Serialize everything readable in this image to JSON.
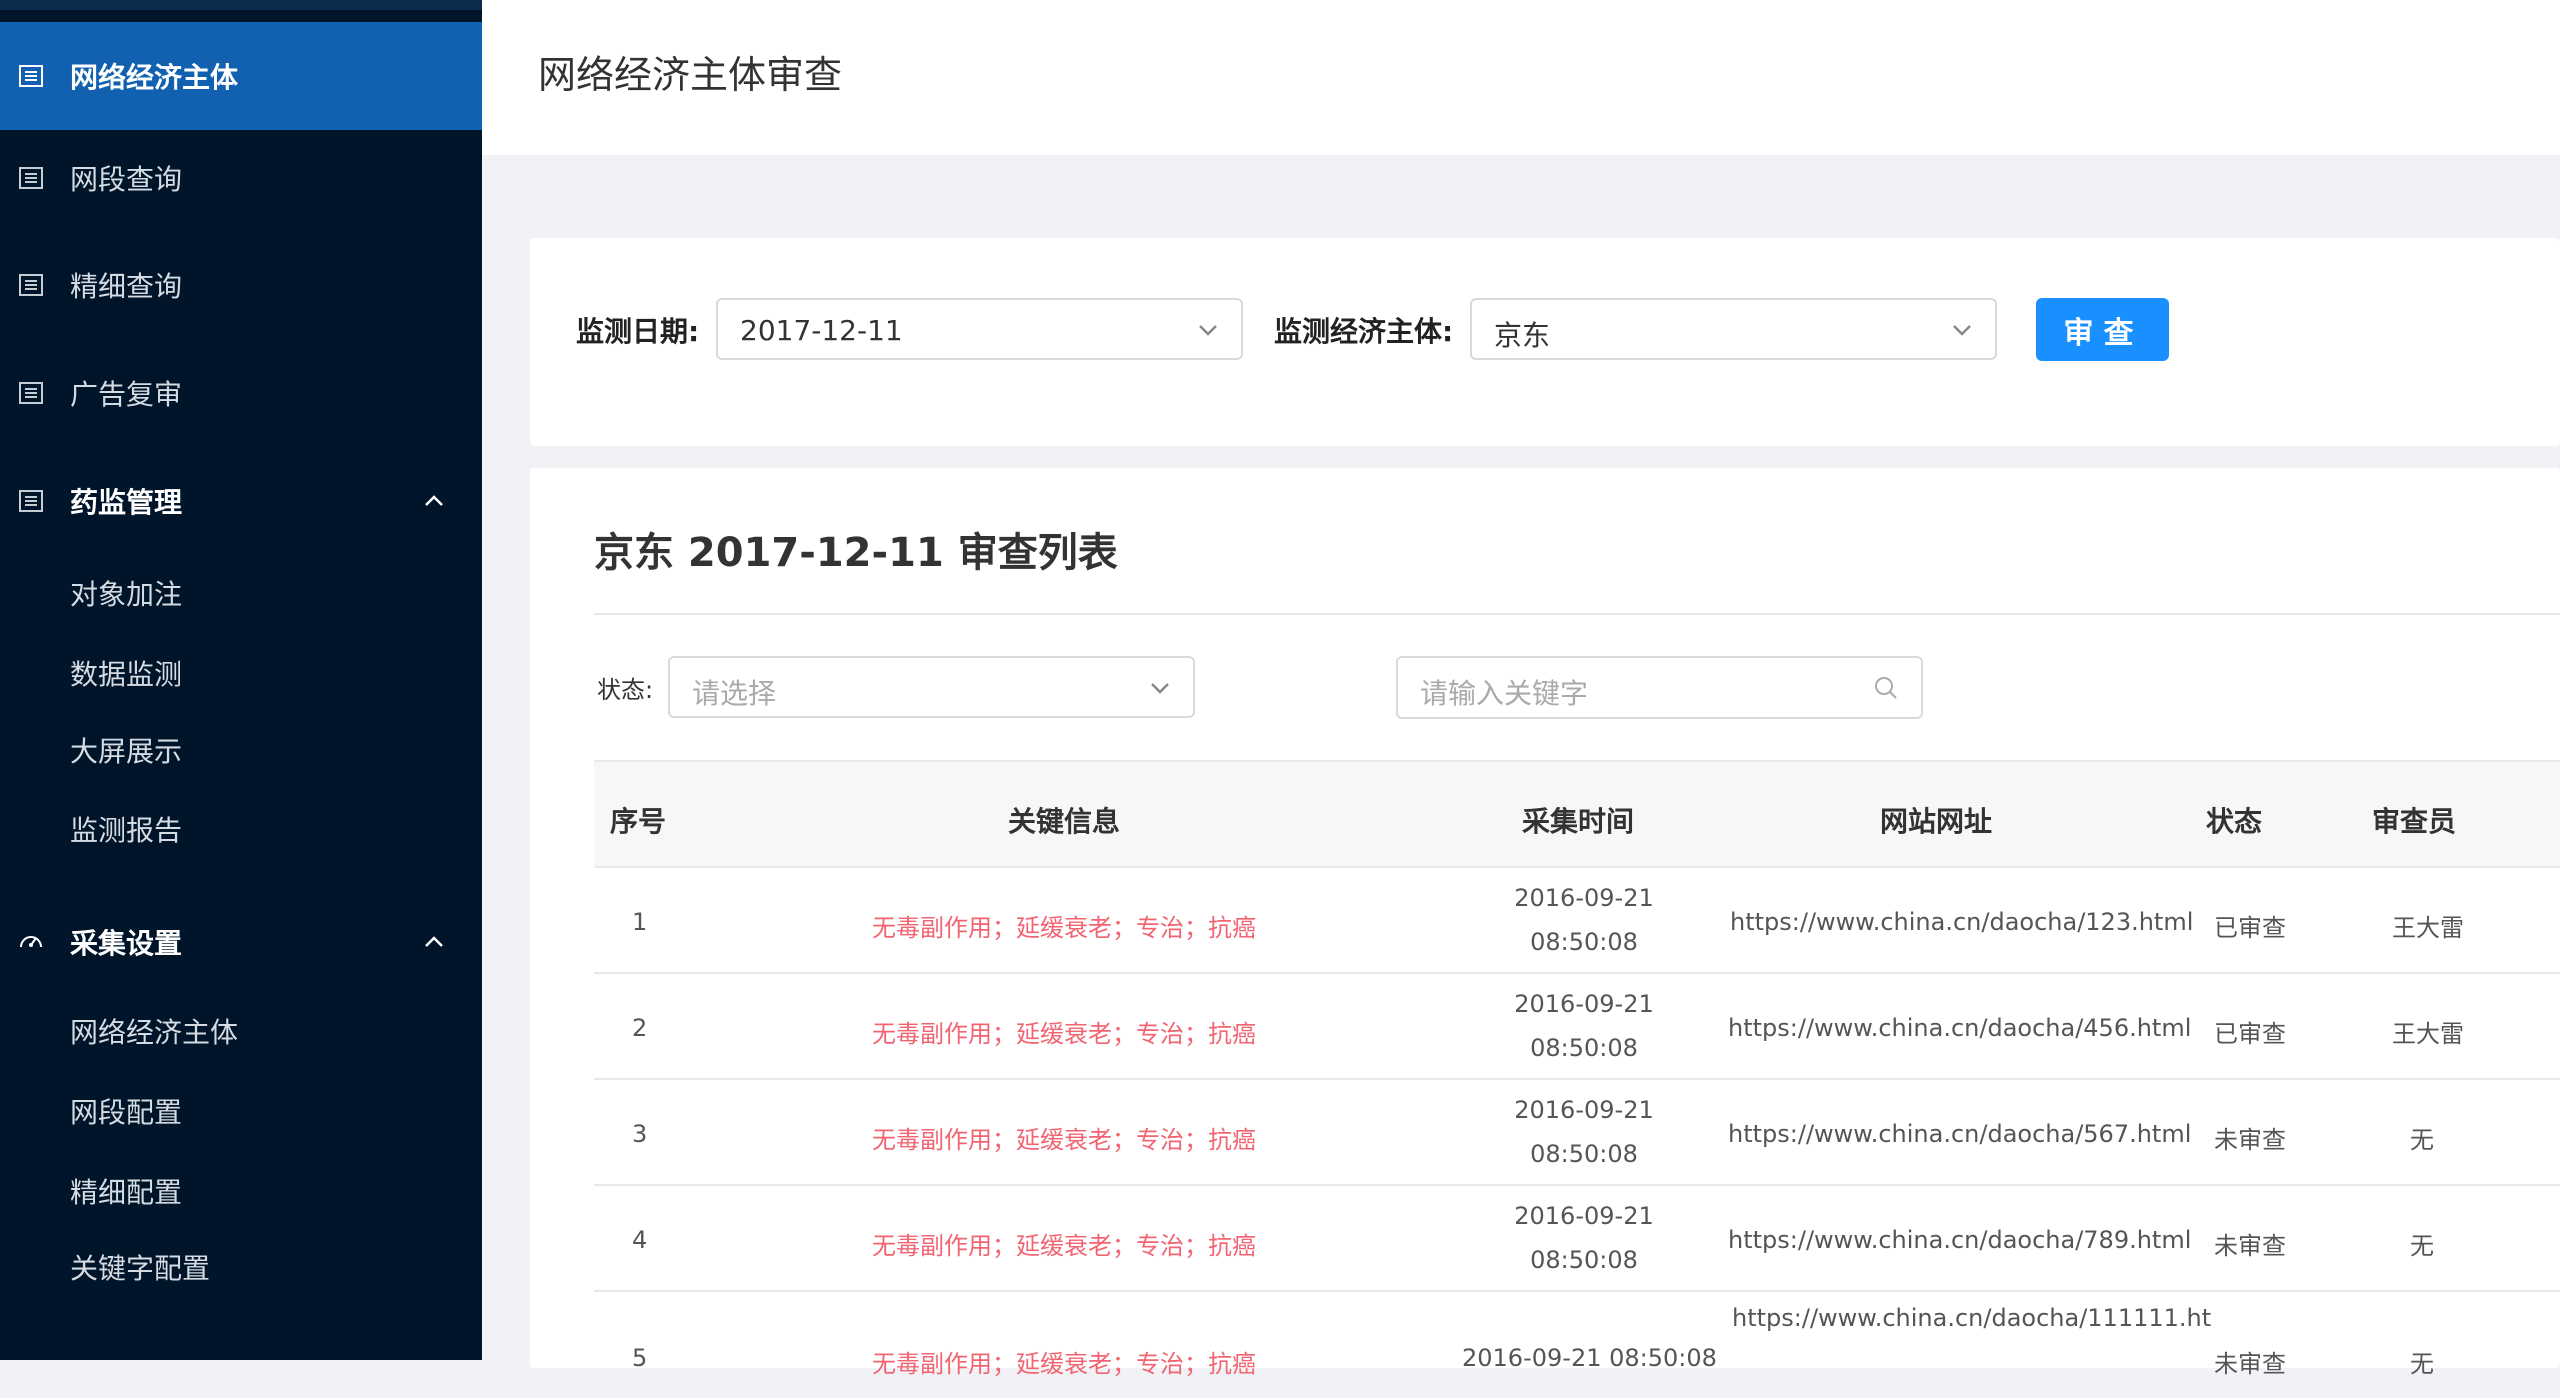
{
  "sidebar": {
    "items": [
      {
        "label": "网络经济主体",
        "icon": "list-icon",
        "active": true
      },
      {
        "label": "网段查询",
        "icon": "list-icon"
      },
      {
        "label": "精细查询",
        "icon": "list-icon"
      },
      {
        "label": "广告复审",
        "icon": "list-icon"
      },
      {
        "label": "药监管理",
        "icon": "list-icon",
        "open": true,
        "children": [
          "对象加注",
          "数据监测",
          "大屏展示",
          "监测报告"
        ]
      },
      {
        "label": "采集设置",
        "icon": "gauge-icon",
        "open": true,
        "children": [
          "网络经济主体",
          "网段配置",
          "精细配置",
          "关键字配置"
        ]
      }
    ]
  },
  "header": {
    "title": "网络经济主体审查"
  },
  "search_form": {
    "date_label": "监测日期:",
    "date_value": "2017-12-11",
    "entity_label": "监测经济主体:",
    "entity_value": "京东",
    "submit_label": "审查"
  },
  "list": {
    "title": "京东 2017-12-11 审查列表",
    "status_filter_label": "状态:",
    "status_placeholder": "请选择",
    "keyword_placeholder": "请输入关键字",
    "columns": [
      "序号",
      "关键信息",
      "采集时间",
      "网站网址",
      "状态",
      "审查员"
    ],
    "rows": [
      {
        "no": "1",
        "key": "无毒副作用；延缓衰老；专治；抗癌",
        "time1": "2016-09-21",
        "time2": "08:50:08",
        "url": "https://www.china.cn/daocha/123.html",
        "status": "已审查",
        "reviewer": "王大雷"
      },
      {
        "no": "2",
        "key": "无毒副作用；延缓衰老；专治；抗癌",
        "time1": "2016-09-21",
        "time2": "08:50:08",
        "url": "https://www.china.cn/daocha/456.html",
        "status": "已审查",
        "reviewer": "王大雷"
      },
      {
        "no": "3",
        "key": "无毒副作用；延缓衰老；专治；抗癌",
        "time1": "2016-09-21",
        "time2": "08:50:08",
        "url": "https://www.china.cn/daocha/567.html",
        "status": "未审查",
        "reviewer": "无"
      },
      {
        "no": "4",
        "key": "无毒副作用；延缓衰老；专治；抗癌",
        "time1": "2016-09-21",
        "time2": "08:50:08",
        "url": "https://www.china.cn/daocha/789.html",
        "status": "未审查",
        "reviewer": "无"
      },
      {
        "no": "5",
        "key": "无毒副作用；延缓衰老；专治；抗癌",
        "time1": "2016-09-21  08:50:08",
        "time2": "",
        "url": "https://www.china.cn/daocha/111111.ht",
        "status": "未审查",
        "reviewer": "无"
      }
    ]
  },
  "colors": {
    "sidebar_bg": "#00152a",
    "sidebar_active": "#1261b0",
    "primary": "#1890ff",
    "keyword_text": "#f26472"
  }
}
